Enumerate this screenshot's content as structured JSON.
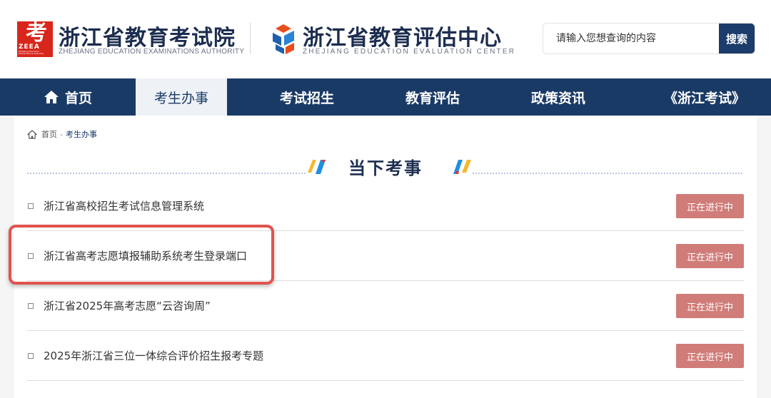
{
  "header": {
    "org1": {
      "logo_zh": "考",
      "logo_en": "ZEEA",
      "logo_tiny": "Zhejiang Education Examinations Authority",
      "title": "浙江省教育考试院",
      "subtitle": "ZHEJIANG EDUCATION EXAMINATIONS AUTHORITY"
    },
    "org2": {
      "title": "浙江省教育评估中心",
      "subtitle": "ZHEJIANG EDUCATION EVALUATION CENTER"
    },
    "search": {
      "placeholder": "请输入您想查询的内容",
      "button_label": "搜索"
    }
  },
  "nav": {
    "items": [
      {
        "label": "首页",
        "icon": "home-icon"
      },
      {
        "label": "考生办事",
        "active": true
      },
      {
        "label": "考试招生"
      },
      {
        "label": "教育评估"
      },
      {
        "label": "政策资讯"
      },
      {
        "label": "《浙江考试》"
      }
    ]
  },
  "breadcrumb": {
    "home": "首页",
    "separator": "-",
    "current": "考生办事"
  },
  "section": {
    "title": "当下考事"
  },
  "list": [
    {
      "text": "浙江省高校招生考试信息管理系统",
      "status": "正在进行中"
    },
    {
      "text": "浙江省高考志愿填报辅助系统考生登录端口",
      "status": "正在进行中"
    },
    {
      "text": "浙江省2025年高考志愿“云咨询周”",
      "status": "正在进行中"
    },
    {
      "text": "2025年浙江省三位一体综合评价招生报考专题",
      "status": "正在进行中"
    }
  ],
  "colors": {
    "nav_bg": "#1a3a66",
    "brand_red": "#d9261c",
    "status_bg": "#d07c78",
    "highlight": "#e0534f"
  }
}
